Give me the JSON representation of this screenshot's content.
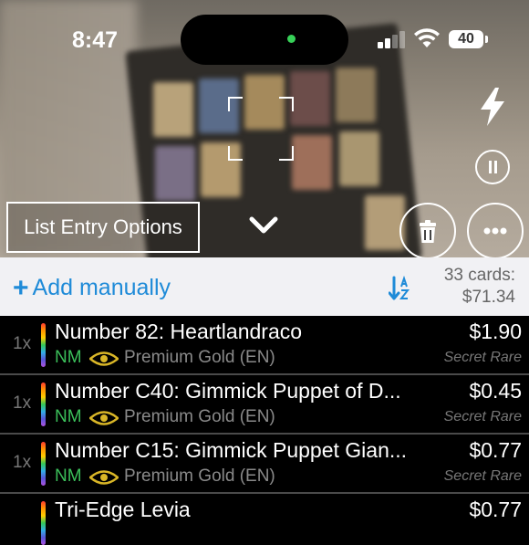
{
  "status": {
    "time": "8:47",
    "battery": "40"
  },
  "camera": {
    "list_entry_options_label": "List Entry Options",
    "icons": [
      "flash-icon",
      "pause-icon",
      "chevron-down-icon",
      "trash-icon",
      "more-icon"
    ]
  },
  "toolbar": {
    "add_label": "Add manually",
    "card_count": "33 cards:",
    "total_value": "$71.34"
  },
  "cards": [
    {
      "qty": "1x",
      "name": "Number 82: Heartlandraco",
      "price": "$1.90",
      "condition": "NM",
      "set": "Premium Gold (EN)",
      "rarity": "Secret Rare"
    },
    {
      "qty": "1x",
      "name": "Number C40: Gimmick Puppet of D...",
      "price": "$0.45",
      "condition": "NM",
      "set": "Premium Gold (EN)",
      "rarity": "Secret Rare"
    },
    {
      "qty": "1x",
      "name": "Number C15: Gimmick Puppet Gian...",
      "price": "$0.77",
      "condition": "NM",
      "set": "Premium Gold (EN)",
      "rarity": "Secret Rare"
    },
    {
      "qty": "",
      "name": "Tri-Edge Levia",
      "price": "$0.77",
      "condition": "",
      "set": "",
      "rarity": ""
    }
  ]
}
